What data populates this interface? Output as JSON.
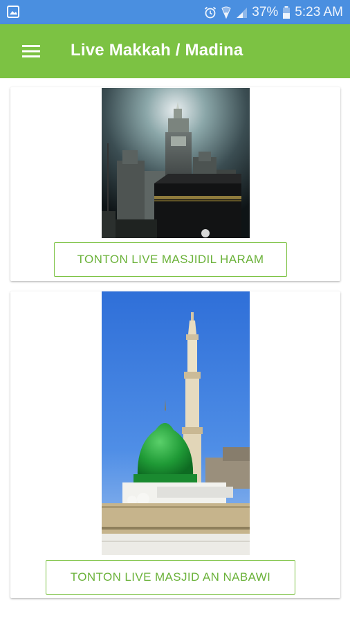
{
  "status_bar": {
    "battery_percent": "37%",
    "time": "5:23 AM",
    "icons": [
      "gallery-icon",
      "alarm-icon",
      "wifi-icon",
      "signal-icon",
      "battery-icon"
    ]
  },
  "app_bar": {
    "title": "Live Makkah / Madina",
    "menu_icon": "hamburger-menu-icon"
  },
  "cards": [
    {
      "image": "masjidil-haram-kaaba-image",
      "button_label": "TONTON LIVE MASJIDIL HARAM"
    },
    {
      "image": "masjid-nabawi-green-dome-image",
      "button_label": "TONTON LIVE MASJID AN NABAWI"
    }
  ],
  "colors": {
    "status_bar": "#4a8fe0",
    "app_bar": "#7cc243",
    "button_border": "#7cc243",
    "button_text": "#6bb23a"
  }
}
